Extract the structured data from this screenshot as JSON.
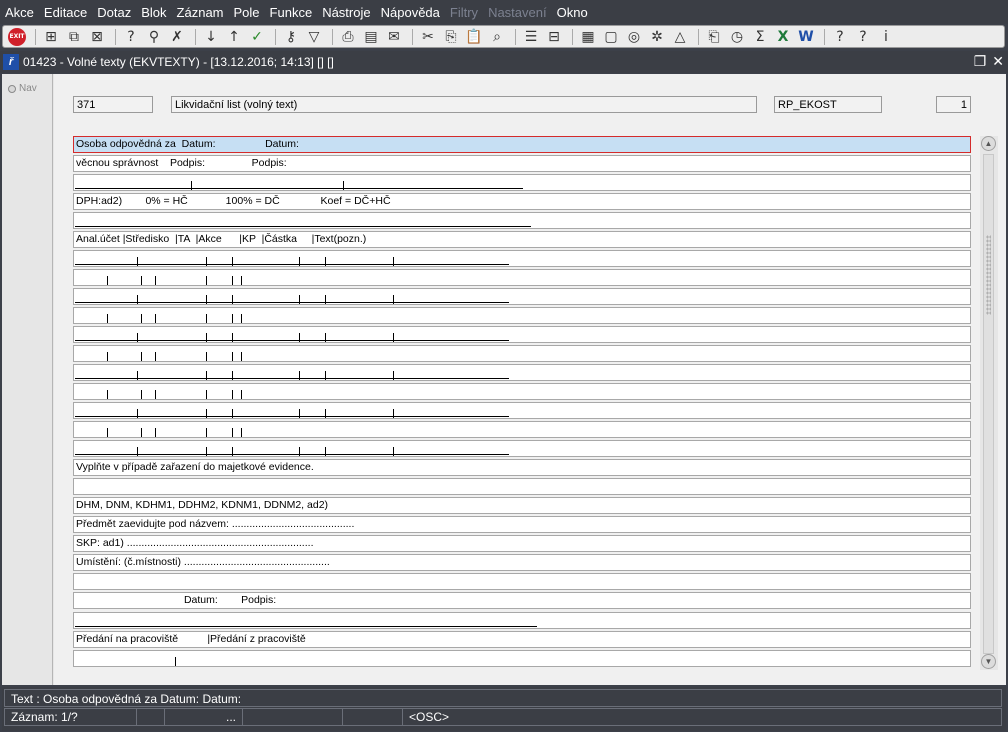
{
  "menu": [
    "Akce",
    "Editace",
    "Dotaz",
    "Blok",
    "Záznam",
    "Pole",
    "Funkce",
    "Nástroje",
    "Nápověda",
    "Filtry",
    "Nastavení",
    "Okno"
  ],
  "menu_disabled": [
    "Filtry",
    "Nastavení"
  ],
  "toolbar_icons": [
    "exit-icon",
    "insert-record-icon",
    "duplicate-record-icon",
    "delete-record-icon",
    "enter-query-icon",
    "execute-query-icon",
    "cancel-query-icon",
    "sort-asc-icon",
    "sort-desc-icon",
    "commit-icon",
    "key-icon",
    "filter-icon",
    "print-icon",
    "print-preview-icon",
    "mail-icon",
    "cut-icon",
    "copy-icon",
    "paste-icon",
    "zoom-icon",
    "list-icon",
    "tree-icon",
    "calculator-icon",
    "note-icon",
    "globe-icon",
    "settings-icon",
    "triangle-icon",
    "attachment-icon",
    "clock-icon",
    "sum-icon",
    "excel-icon",
    "word-icon",
    "help-icon",
    "whats-this-icon",
    "info-icon"
  ],
  "window": {
    "title": "01423 - Volné texty (EKVTEXTY) - [13.12.2016; 14:13]  []  []",
    "app_icon": "ř"
  },
  "nav": {
    "label": "Nav"
  },
  "header": {
    "code": "371",
    "name": "Likvidační list (volný text)",
    "report": "RP_EKOST",
    "page": "1"
  },
  "lines": [
    "Osoba odpovědná za  Datum:                 Datum:",
    "věcnou správnost    Podpis:                Podpis:",
    "",
    "DPH:ad2)        0% = HČ             100% = DČ              Koef = DČ+HČ",
    "",
    "Anal.účet |Středisko  |TA  |Akce      |KP  |Částka     |Text(pozn.)",
    "",
    "",
    "",
    "",
    "",
    "",
    "",
    "",
    "",
    "",
    "",
    "Vyplňte v případě zařazení do majetkové evidence.",
    "",
    "DHM, DNM, KDHM1, DDHM2, KDNM1, DDNM2, ad2)",
    "Předmět zaevidujte pod názvem: ..........................................",
    "SKP: ad1) ................................................................",
    "Umístění: (č.místnosti) ..................................................",
    "",
    "                                     Datum:        Podpis:",
    "",
    "Předání na pracoviště          |Předání z pracoviště",
    ""
  ],
  "status": {
    "text": "Text : Osoba odpovědná za  Datum:                    Datum:",
    "record": "Záznam: 1/?",
    "dots": "...",
    "mode": "<OSC>"
  }
}
